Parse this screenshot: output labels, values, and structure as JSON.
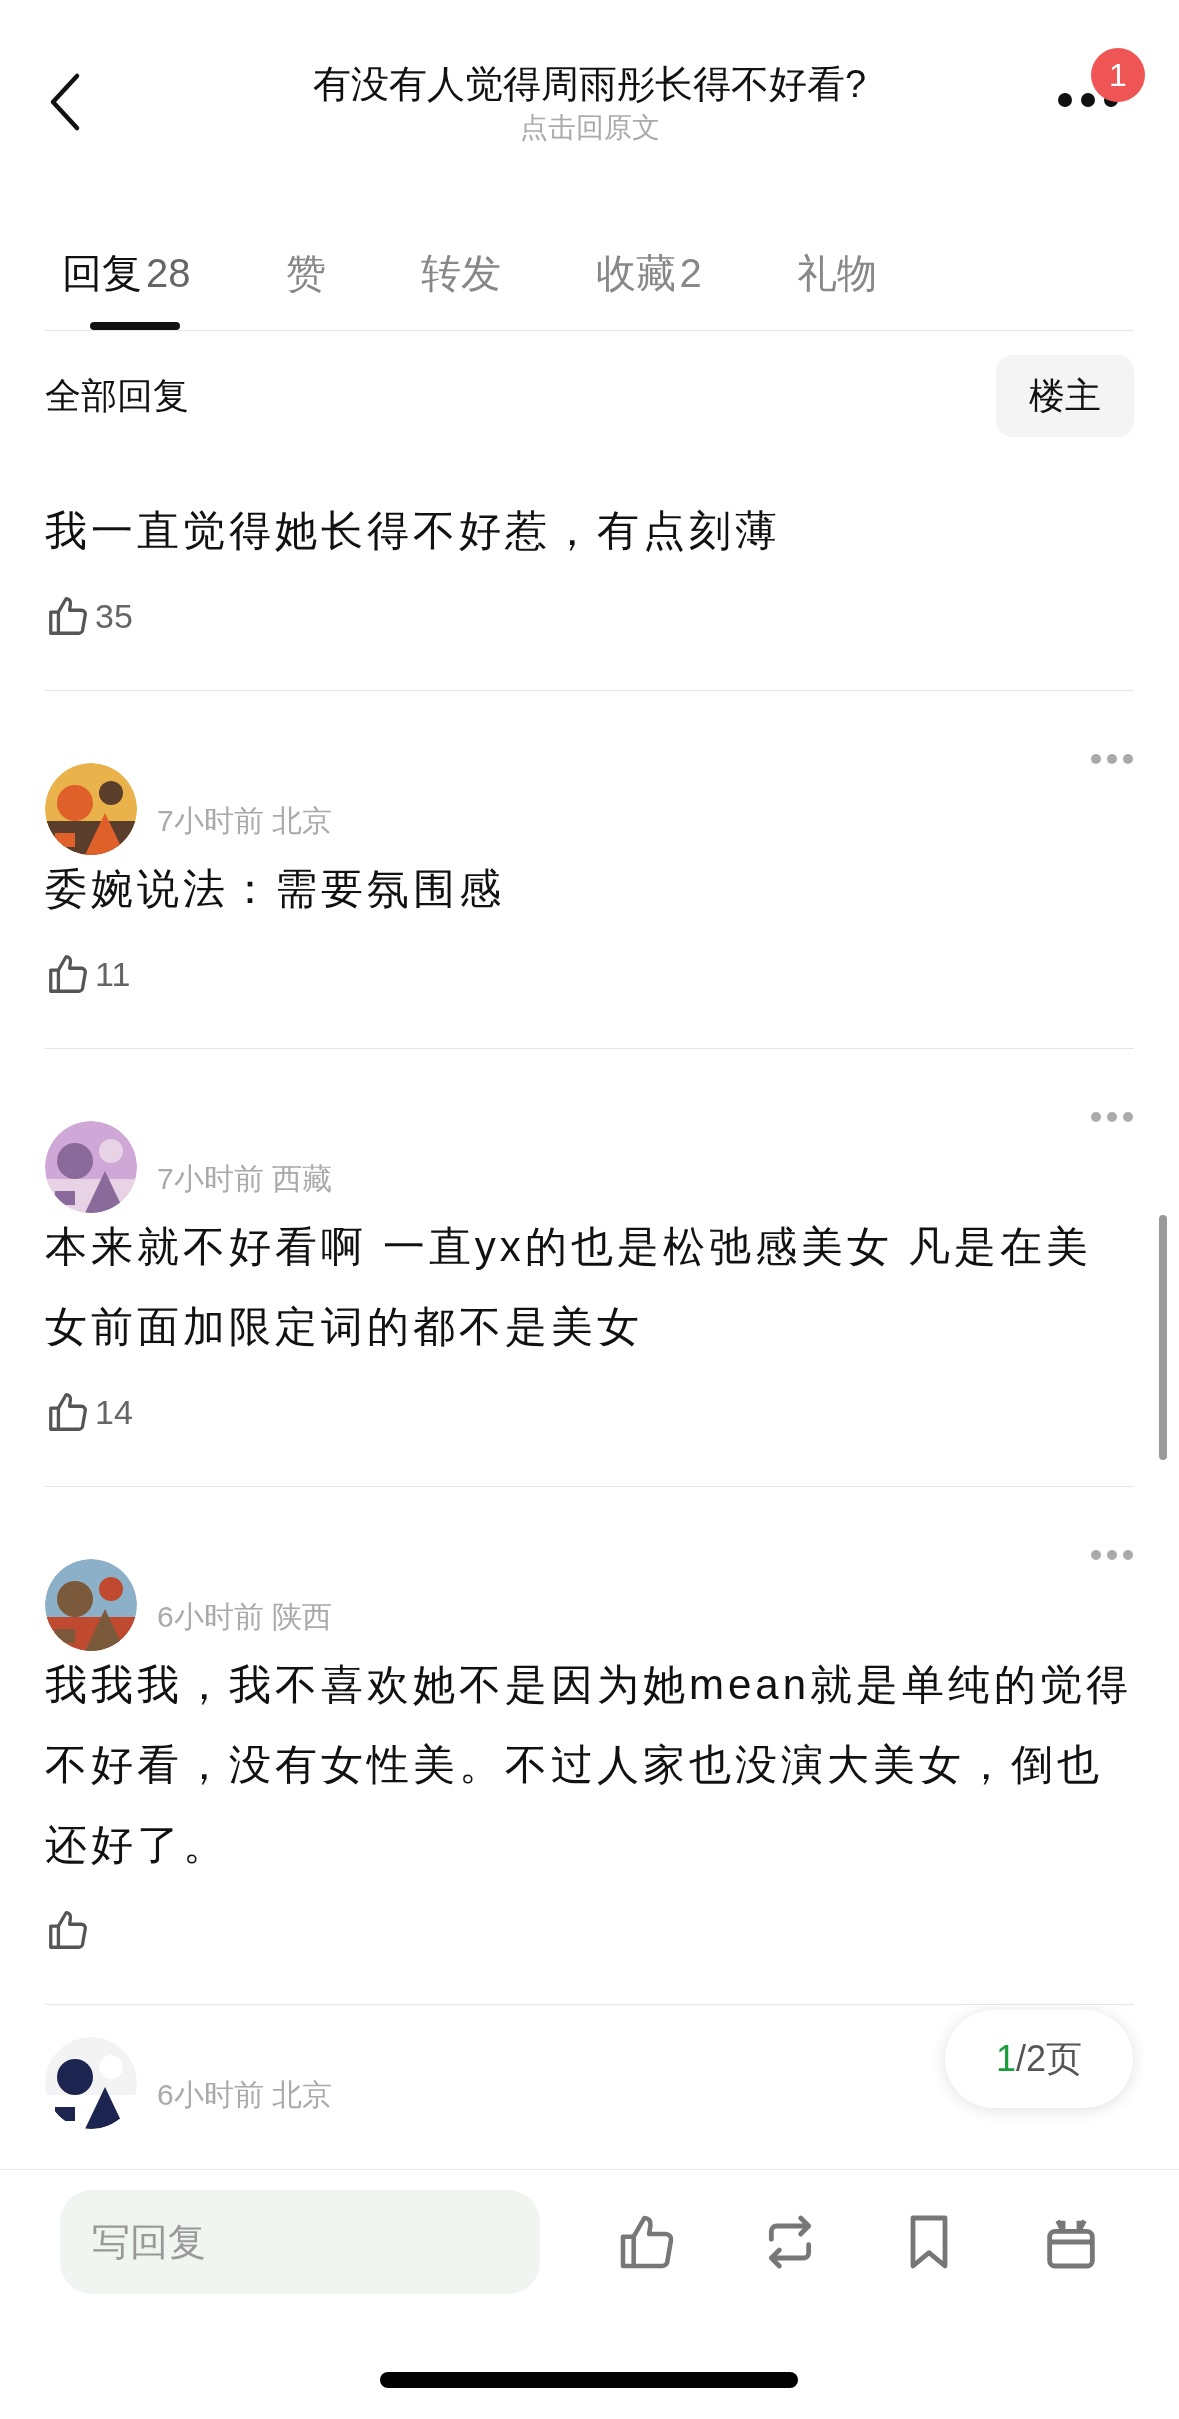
{
  "header": {
    "title": "有没有人觉得周雨彤长得不好看?",
    "subtitle": "点击回原文",
    "badge": "1"
  },
  "tabs": [
    {
      "label": "回复",
      "count": "28",
      "selected": true
    },
    {
      "label": "赞",
      "selected": false
    },
    {
      "label": "转发",
      "selected": false
    },
    {
      "label": "收藏",
      "count": "2",
      "selected": false
    },
    {
      "label": "礼物",
      "selected": false
    }
  ],
  "filter": {
    "label": "全部回复",
    "button": "楼主"
  },
  "comments": [
    {
      "text": "我一直觉得她长得不好惹，有点刻薄",
      "likes": "35"
    },
    {
      "menu": true,
      "meta": "7小时前 北京",
      "text": "委婉说法：需要氛围感",
      "likes": "11"
    },
    {
      "menu": true,
      "meta": "7小时前 西藏",
      "text": "本来就不好看啊 一直yx的也是松弛感美女 凡是在美女前面加限定词的都不是美女",
      "likes": "14"
    },
    {
      "menu": true,
      "meta": "6小时前 陕西",
      "text": "我我我，我不喜欢她不是因为她mean就是单纯的觉得不好看，没有女性美。不过人家也没演大美女，倒也还好了。"
    },
    {
      "meta": "6小时前 北京"
    }
  ],
  "pager": {
    "current": "1",
    "rest": "/2页"
  },
  "reply_bar": {
    "placeholder": "写回复"
  }
}
